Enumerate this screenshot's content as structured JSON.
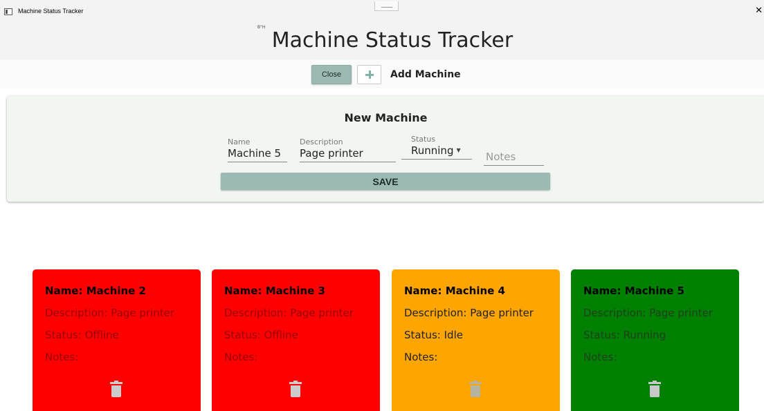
{
  "window": {
    "title": "Machine Status Tracker",
    "close_glyph": "✕"
  },
  "header": {
    "bh": "B\"H",
    "title": "Machine Status Tracker"
  },
  "toolbar": {
    "close_label": "Close",
    "add_label": "Add Machine",
    "add_icon": "plus-icon"
  },
  "form": {
    "title": "New Machine",
    "name_label": "Name",
    "name_value": "Machine 5",
    "description_label": "Description",
    "description_value": "Page printer",
    "status_label": "Status",
    "status_value": "Running",
    "notes_placeholder": "Notes",
    "save_label": "SAVE"
  },
  "colors": {
    "accent": "#9cbab3",
    "offline": "#ff0000",
    "idle": "#ffa500",
    "running": "#008000"
  },
  "machines": [
    {
      "name": "Name: Machine 2",
      "description": "Description: Page printer",
      "status": "Status: Offline",
      "notes": "Notes:",
      "bg": "#ff0000",
      "name_color": "#000000",
      "text_color": "#990000",
      "trash_color": "#cccccc"
    },
    {
      "name": "Name: Machine 3",
      "description": "Description: Page printer",
      "status": "Status: Offline",
      "notes": "Notes:",
      "bg": "#ff0000",
      "name_color": "#000000",
      "text_color": "#990000",
      "trash_color": "#cccccc"
    },
    {
      "name": "Name: Machine 4",
      "description": "Description: Page printer",
      "status": "Status: Idle",
      "notes": "Notes:",
      "bg": "#ffa500",
      "name_color": "#000000",
      "text_color": "#222222",
      "trash_color": "#b4b4a0"
    },
    {
      "name": "Name: Machine 5",
      "description": "Description: Page printer",
      "status": "Status: Running",
      "notes": "Notes:",
      "bg": "#008000",
      "name_color": "#000000",
      "text_color": "#1f3f1f",
      "trash_color": "#c8c8c8"
    }
  ]
}
